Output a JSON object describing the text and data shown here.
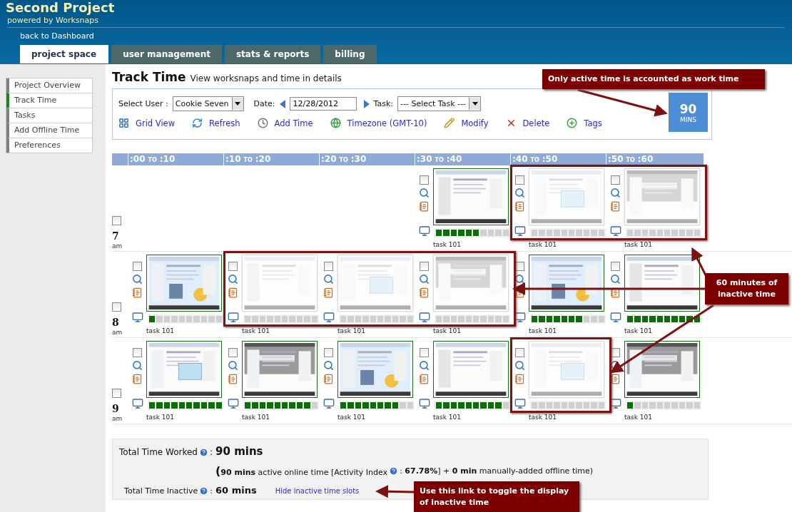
{
  "header": {
    "title": "Second Project",
    "subtitle": "powered by Worksnaps",
    "back_link": "back to Dashboard"
  },
  "tabs": [
    {
      "label": "project space",
      "selected": true
    },
    {
      "label": "user management",
      "selected": false
    },
    {
      "label": "stats & reports",
      "selected": false
    },
    {
      "label": "billing",
      "selected": false
    }
  ],
  "sidebar": {
    "items": [
      {
        "label": "Project Overview",
        "selected": false
      },
      {
        "label": "Track Time",
        "selected": true
      },
      {
        "label": "Tasks",
        "selected": false
      },
      {
        "label": "Add Offline Time",
        "selected": false
      },
      {
        "label": "Preferences",
        "selected": false
      }
    ]
  },
  "page": {
    "title": "Track Time",
    "subtitle": "View worksnaps and time in details"
  },
  "filters": {
    "user_label": "Select User :",
    "user": "Cookie Seven",
    "date_label": "Date:",
    "date": "12/28/2012",
    "task_label": "Task:",
    "task": "--- Select Task ---"
  },
  "actions": [
    {
      "kind": "grid",
      "label": "Grid View"
    },
    {
      "kind": "refresh",
      "label": "Refresh"
    },
    {
      "kind": "add",
      "label": "Add Time"
    },
    {
      "kind": "timezone",
      "label": "Timezone (GMT-10)"
    },
    {
      "kind": "modify",
      "label": "Modify"
    },
    {
      "kind": "delete",
      "label": "Delete"
    },
    {
      "kind": "tags",
      "label": "Tags"
    }
  ],
  "total_badge": {
    "value": "90",
    "unit": "MINS"
  },
  "grid": {
    "columns": [
      {
        "from": ":00",
        "sep": "TO",
        "to": ":10"
      },
      {
        "from": ":10",
        "sep": "TO",
        "to": ":20"
      },
      {
        "from": ":20",
        "sep": "TO",
        "to": ":30"
      },
      {
        "from": ":30",
        "sep": "TO",
        "to": ":40"
      },
      {
        "from": ":40",
        "sep": "TO",
        "to": ":50"
      },
      {
        "from": ":50",
        "sep": "TO",
        "to": ":60"
      }
    ],
    "rows": [
      {
        "hour": "7",
        "period": "am",
        "checked": false,
        "slots": [
          {
            "kind": "empty"
          },
          {
            "kind": "empty"
          },
          {
            "kind": "empty"
          },
          {
            "kind": "snap",
            "checked": false,
            "active": true,
            "level": 0.6,
            "task": "task 101"
          },
          {
            "kind": "snap",
            "checked": false,
            "active": false,
            "level": 0,
            "task": "task 101"
          },
          {
            "kind": "snap",
            "checked": false,
            "active": false,
            "level": 0,
            "task": "task 101"
          }
        ]
      },
      {
        "hour": "8",
        "period": "am",
        "checked": false,
        "slots": [
          {
            "kind": "snap",
            "checked": false,
            "active": true,
            "level": 0.1,
            "task": "task 101"
          },
          {
            "kind": "snap",
            "checked": false,
            "active": false,
            "level": 0,
            "task": "task 101"
          },
          {
            "kind": "snap",
            "checked": false,
            "active": false,
            "level": 0,
            "task": "task 101"
          },
          {
            "kind": "snap",
            "checked": false,
            "active": false,
            "level": 0,
            "task": "task 101"
          },
          {
            "kind": "snap",
            "checked": false,
            "active": true,
            "level": 0.7,
            "task": "task 101"
          },
          {
            "kind": "snap",
            "checked": false,
            "active": true,
            "level": 1,
            "task": "task 101"
          }
        ]
      },
      {
        "hour": "9",
        "period": "am",
        "checked": false,
        "slots": [
          {
            "kind": "snap",
            "checked": false,
            "active": true,
            "level": 1,
            "task": "task 101"
          },
          {
            "kind": "snap",
            "checked": false,
            "active": true,
            "level": 0.9,
            "task": "task 101"
          },
          {
            "kind": "snap",
            "checked": false,
            "active": true,
            "level": 0.8,
            "task": "task 101"
          },
          {
            "kind": "snap",
            "checked": false,
            "active": true,
            "level": 0.9,
            "task": "task 101"
          },
          {
            "kind": "snap",
            "checked": false,
            "active": false,
            "level": 0,
            "task": "task 101"
          },
          {
            "kind": "snap",
            "checked": false,
            "active": true,
            "level": 0.1,
            "task": "task 101"
          }
        ]
      }
    ]
  },
  "totals": {
    "worked_label": "Total Time Worked",
    "worked_colon": ":",
    "inactive_colon": ":",
    "worked": "90 mins",
    "online": "(**90 mins** active online time [Activity Index",
    "offline": ": **67.78%**]  +  **0 min** manually-added offline time)",
    "inactive_label": "Total Time Inactive",
    "inactive": "60 mins",
    "toggle_link": "Hide inactive time slots"
  },
  "callouts": [
    {
      "text": "Only active time is accounted as work time"
    },
    {
      "text": "60 minutes of inactive time"
    },
    {
      "text": "Use this link to toggle the display of inactive time"
    }
  ]
}
